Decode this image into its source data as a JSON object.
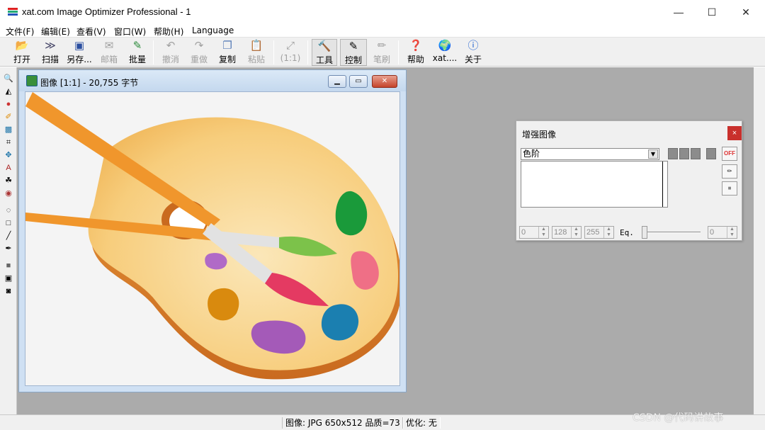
{
  "app": {
    "title": "xat.com  Image Optimizer Professional - 1",
    "window_controls": {
      "minimize": "—",
      "maximize": "☐",
      "close": "✕"
    }
  },
  "menu": [
    "文件(F)",
    "编辑(E)",
    "查看(V)",
    "窗口(W)",
    "帮助(H)",
    "Language"
  ],
  "toolbar": {
    "open": "打开",
    "scan": "扫描",
    "save_as": "另存...",
    "email": "邮箱",
    "batch": "批量",
    "undo": "撤消",
    "redo": "重做",
    "copy": "复制",
    "paste": "粘贴",
    "zoom": "(1:1)",
    "tools": "工具",
    "control": "控制",
    "brush": "笔刷",
    "help": "帮助",
    "xat": "xat....",
    "about": "关于"
  },
  "image_window": {
    "title": "图像  [1:1] - 20,755 字节",
    "close_label": "✕"
  },
  "enhance": {
    "title": "增强图像",
    "close_label": "×",
    "mode": "色阶",
    "off_label": "OFF",
    "spin1": "0",
    "spin2": "128",
    "spin3": "255",
    "eq_label": "Eq.",
    "spin4": "0"
  },
  "status": {
    "image_info": "图像: JPG 650x512  品质=73",
    "optimize": "优化: 无"
  },
  "watermark": "CSDN @代码讲故事",
  "colors": {
    "workspace": "#ababab",
    "palette_wood": "#f6c46f",
    "brush_handle": "#f0962c",
    "close_red": "#c9302c"
  }
}
